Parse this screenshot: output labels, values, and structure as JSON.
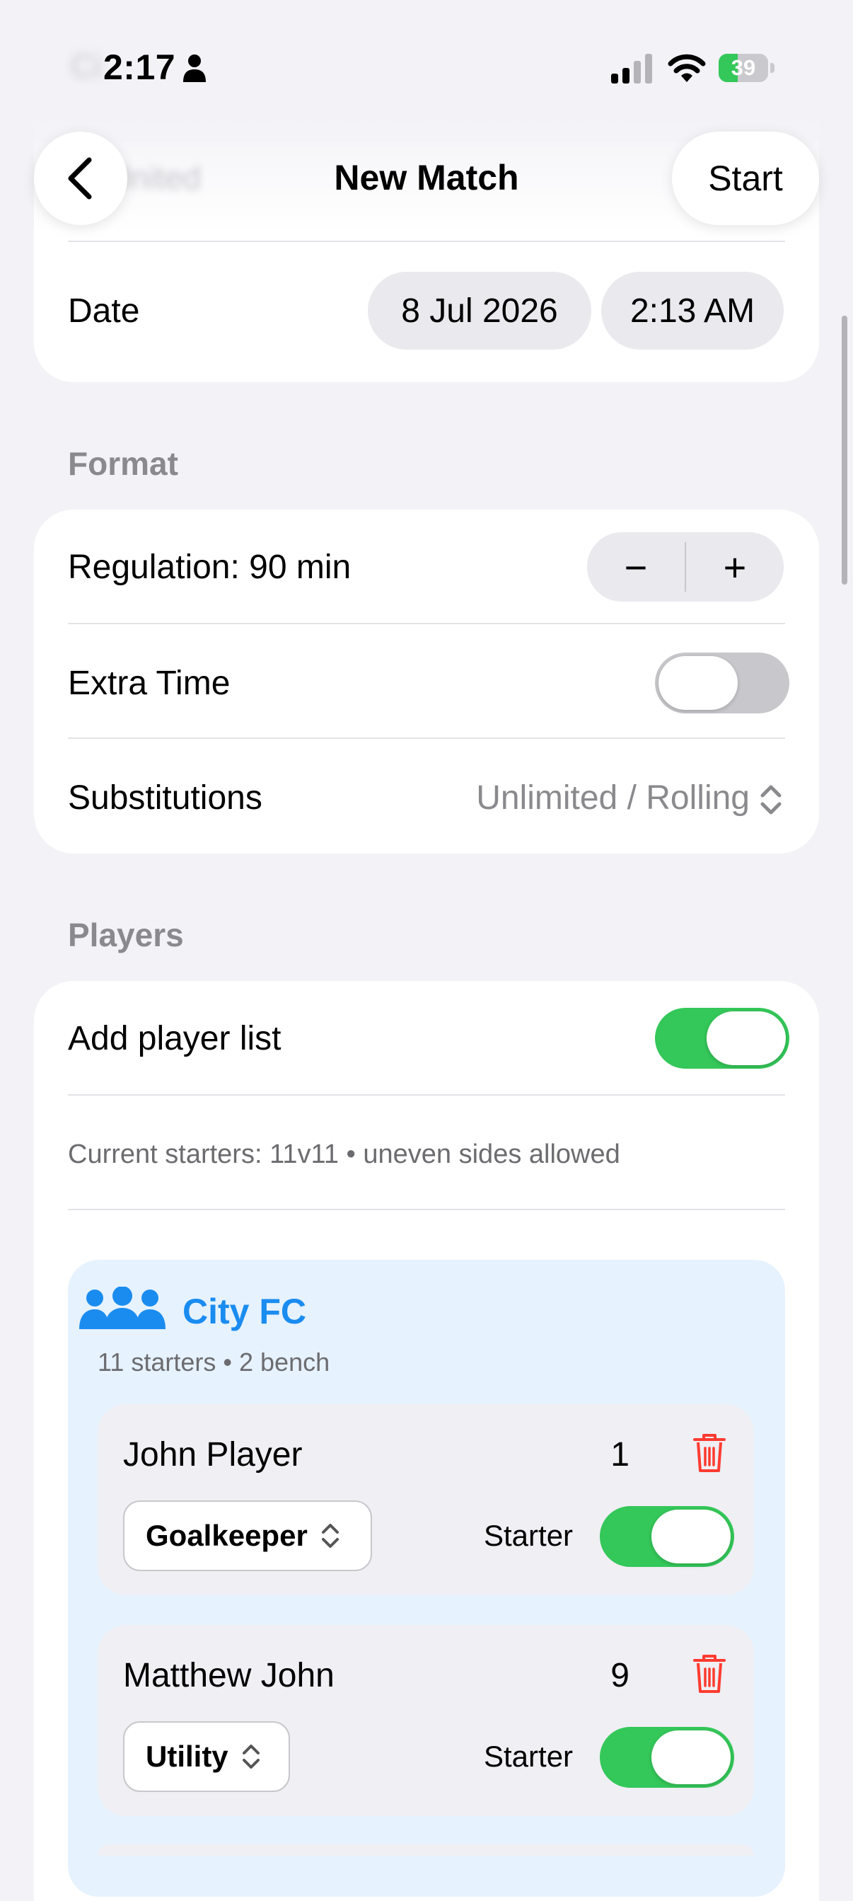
{
  "status": {
    "time": "2:17",
    "battery": "39",
    "battery_level": 0.39
  },
  "nav": {
    "blurred_top": "Ci",
    "blurred_team": "m United",
    "title": "New Match",
    "start_label": "Start"
  },
  "date_row": {
    "label": "Date",
    "date": "8 Jul 2026",
    "time": "2:13 AM"
  },
  "format": {
    "header": "Format",
    "regulation_label": "Regulation: 90 min",
    "stepper_minus": "−",
    "stepper_plus": "+",
    "extra_time_label": "Extra Time",
    "extra_time_on": false,
    "substitutions_label": "Substitutions",
    "substitutions_value": "Unlimited / Rolling"
  },
  "players": {
    "header": "Players",
    "add_list_label": "Add player list",
    "add_list_on": true,
    "note": "Current starters: 11v11 • uneven sides allowed",
    "team": {
      "name": "City FC",
      "summary": "11 starters • 2 bench",
      "roster": [
        {
          "name": "John Player",
          "number": "1",
          "position": "Goalkeeper",
          "role_label": "Starter",
          "starter": true
        },
        {
          "name": "Matthew John",
          "number": "9",
          "position": "Utility",
          "role_label": "Starter",
          "starter": true
        }
      ]
    }
  },
  "colors": {
    "accent": "#1A8CF0",
    "toggle_on": "#34C759",
    "toggle_off": "#C7C7CC",
    "delete": "#FF3B30"
  }
}
